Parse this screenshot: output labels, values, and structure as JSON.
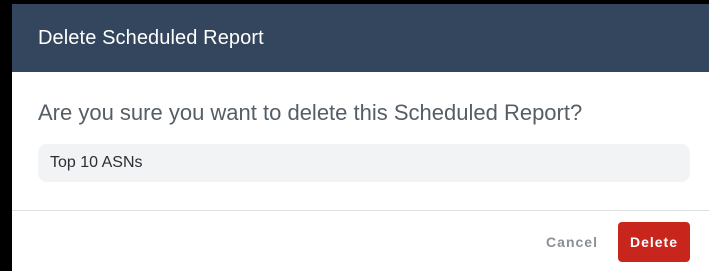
{
  "dialog": {
    "title": "Delete Scheduled Report",
    "question": "Are you sure you want to delete this Scheduled Report?",
    "report_name": "Top 10 ASNs"
  },
  "footer": {
    "cancel_label": "Cancel",
    "delete_label": "Delete"
  },
  "colors": {
    "header_bg": "#34465d",
    "delete_button_bg": "#c8261d",
    "chip_bg": "#f2f3f4"
  }
}
